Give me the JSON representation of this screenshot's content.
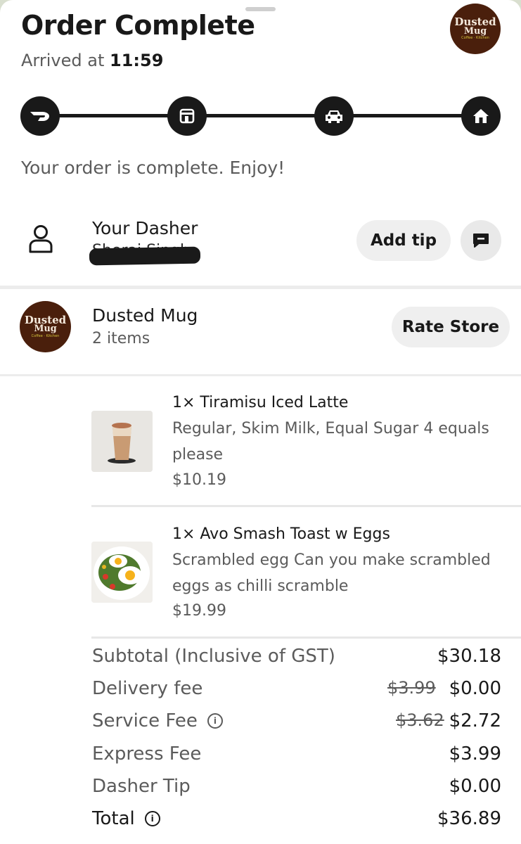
{
  "header": {
    "title": "Order Complete",
    "arrived_prefix": "Arrived at",
    "arrived_time": "11:59",
    "store_logo_text_1": "Dusted",
    "store_logo_text_2": "Mug",
    "store_logo_sub": "Coffee · Kitchen"
  },
  "progress": {
    "steps": [
      "dasher-icon",
      "store-icon",
      "car-icon",
      "home-icon"
    ],
    "completed_fraction": 1.0
  },
  "status_message": "Your order is complete. Enjoy!",
  "dasher": {
    "label": "Your Dasher",
    "name": "Sherai Singh",
    "add_tip_label": "Add tip"
  },
  "store": {
    "name": "Dusted Mug",
    "item_count": "2 items",
    "rate_label": "Rate Store"
  },
  "items": [
    {
      "name": "1× Tiramisu Iced Latte",
      "options": "Regular, Skim Milk, Equal Sugar 4 equals please",
      "price": "$10.19"
    },
    {
      "name": "1× Avo Smash Toast w Eggs",
      "options": "Scrambled egg Can you make scrambled eggs as chilli scramble",
      "price": "$19.99"
    }
  ],
  "summary": {
    "subtotal_label": "Subtotal (Inclusive of GST)",
    "subtotal_value": "$30.18",
    "delivery_label": "Delivery fee",
    "delivery_original": "$3.99",
    "delivery_value": "$0.00",
    "service_label": "Service Fee",
    "service_original": "$3.62",
    "service_value": "$2.72",
    "express_label": "Express Fee",
    "express_value": "$3.99",
    "tip_label": "Dasher Tip",
    "tip_value": "$0.00",
    "total_label": "Total",
    "total_value": "$36.89"
  },
  "colors": {
    "primary_dark": "#191919",
    "muted_text": "#5b5b5b",
    "pill_bg": "#efefef",
    "logo_bg": "#4a1f0c"
  }
}
